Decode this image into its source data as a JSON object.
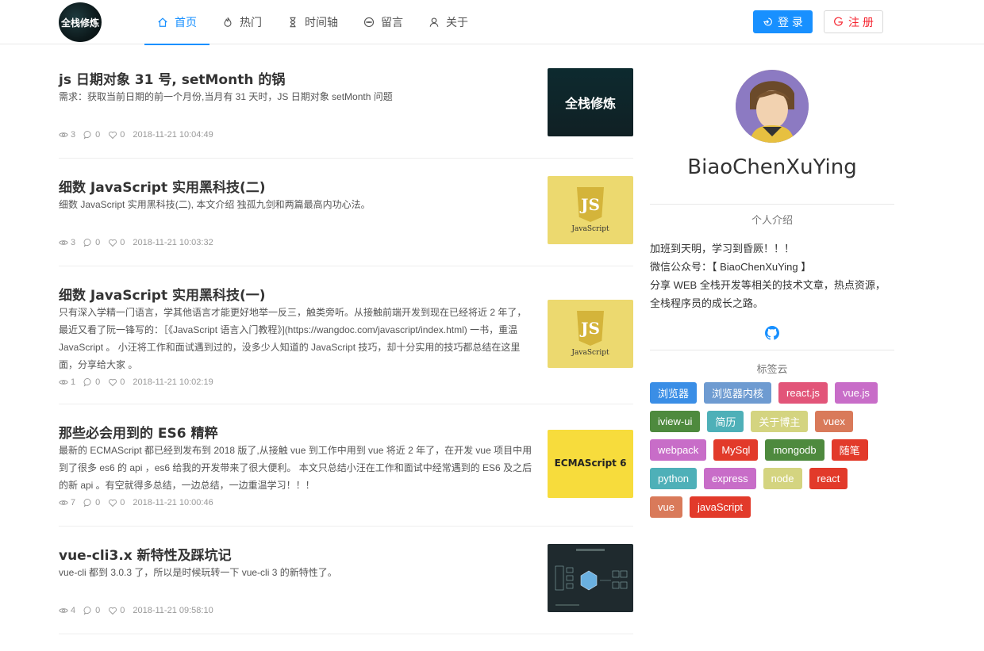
{
  "header": {
    "logo_text": "全栈修炼",
    "nav": [
      {
        "label": "首页",
        "icon": "home-icon",
        "active": true
      },
      {
        "label": "热门",
        "icon": "fire-icon"
      },
      {
        "label": "时间轴",
        "icon": "hourglass-icon"
      },
      {
        "label": "留言",
        "icon": "message-icon"
      },
      {
        "label": "关于",
        "icon": "user-icon"
      }
    ],
    "login_label": "登 录",
    "register_label": "注 册",
    "accent_color": "#1890ff",
    "register_color": "#f5222d"
  },
  "articles": [
    {
      "title": "js 日期对象 31 号, setMonth 的锅",
      "desc": "需求：获取当前日期的前一个月份,当月有 31 天时，JS 日期对象 setMonth 问题",
      "views": "3",
      "comments": "0",
      "likes": "0",
      "date": "2018-11-21 10:04:49",
      "thumb_text": "全栈修炼"
    },
    {
      "title": "细数 JavaScript 实用黑科技(二)",
      "desc": "细数 JavaScript 实用黑科技(二), 本文介绍 独孤九剑和两篇最高内功心法。",
      "views": "3",
      "comments": "0",
      "likes": "0",
      "date": "2018-11-21 10:03:32",
      "thumb_text": "JavaScript"
    },
    {
      "title": "细数 JavaScript 实用黑科技(一)",
      "desc": "只有深入学精一门语言，学其他语言才能更好地举一反三，触类旁听。从接触前端开发到现在已经将近 2 年了，最近又看了阮一锋写的：［《JavaScript 语言入门教程》](https://wangdoc.com/javascript/index.html) 一书，重温 JavaScript 。 小汪将工作和面试遇到过的，没多少人知道的 JavaScript 技巧，却十分实用的技巧都总结在这里面，分享给大家 。",
      "views": "1",
      "comments": "0",
      "likes": "0",
      "date": "2018-11-21 10:02:19",
      "thumb_text": "JavaScript"
    },
    {
      "title": "那些必会用到的 ES6 精粹",
      "desc": "最新的 ECMAScript 都已经到发布到 2018 版了,从接触 vue 到工作中用到 vue 将近 2 年了，在开发 vue 项目中用到了很多 es6 的 api ，es6 给我的开发带来了很大便利。 本文只总结小汪在工作和面试中经常遇到的 ES6 及之后的新 api 。有空就得多总结，一边总结，一边重温学习！！！",
      "views": "7",
      "comments": "0",
      "likes": "0",
      "date": "2018-11-21 10:00:46",
      "thumb_text": "ECMAScript 6"
    },
    {
      "title": "vue-cli3.x 新特性及踩坑记",
      "desc": "vue-cli 都到 3.0.3 了，所以是时候玩转一下 vue-cli 3 的新特性了。",
      "views": "4",
      "comments": "0",
      "likes": "0",
      "date": "2018-11-21 09:58:10"
    }
  ],
  "sidebar": {
    "username": "BiaoChenXuYing",
    "intro_title": "个人介绍",
    "bio_line1": "加班到天明，学习到昏厥！！！",
    "bio_line2": "微信公众号：【 BiaoChenXuYing 】",
    "bio_line3": "分享 WEB 全栈开发等相关的技术文章，热点资源，全栈程序员的成长之路。",
    "tags_title": "标签云",
    "tags": [
      {
        "label": "浏览器",
        "color": "#3a8ee6"
      },
      {
        "label": "浏览器内核",
        "color": "#6e9bd1"
      },
      {
        "label": "react.js",
        "color": "#e25579"
      },
      {
        "label": "vue.js",
        "color": "#c86dc8"
      },
      {
        "label": "iview-ui",
        "color": "#4e8a3e"
      },
      {
        "label": "简历",
        "color": "#4eb0b8"
      },
      {
        "label": "关于博主",
        "color": "#d4d480"
      },
      {
        "label": "vuex",
        "color": "#d97a5a"
      },
      {
        "label": "webpack",
        "color": "#c86dc8"
      },
      {
        "label": "MySql",
        "color": "#e23a2a"
      },
      {
        "label": "mongodb",
        "color": "#4e8a3e"
      },
      {
        "label": "随笔",
        "color": "#e23a2a"
      },
      {
        "label": "python",
        "color": "#4eb0b8"
      },
      {
        "label": "express",
        "color": "#c86dc8"
      },
      {
        "label": "node",
        "color": "#d4d480"
      },
      {
        "label": "react",
        "color": "#e23a2a"
      },
      {
        "label": "vue",
        "color": "#d97a5a"
      },
      {
        "label": "javaScript",
        "color": "#e23a2a"
      }
    ]
  }
}
